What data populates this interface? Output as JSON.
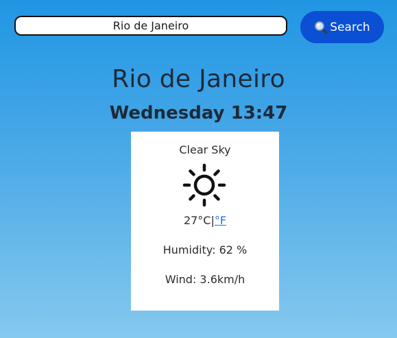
{
  "search": {
    "value": "Rio de Janeiro",
    "button_label": "Search",
    "button_icon": "magnifier-icon"
  },
  "location": {
    "city": "Rio de Janeiro",
    "datetime": "Wednesday 13:47"
  },
  "weather": {
    "condition": "Clear Sky",
    "icon": "sun-icon",
    "temperature": "27",
    "unit_celsius": "°C",
    "unit_separator": "|",
    "unit_fahrenheit": "°F",
    "humidity_label": "Humidity: 62 %",
    "wind_label": "Wind: 3.6km/h"
  },
  "colors": {
    "background_top": "#2196e3",
    "background_bottom": "#85c9ee",
    "button": "#0a4fd4",
    "link": "#1a73e8"
  }
}
